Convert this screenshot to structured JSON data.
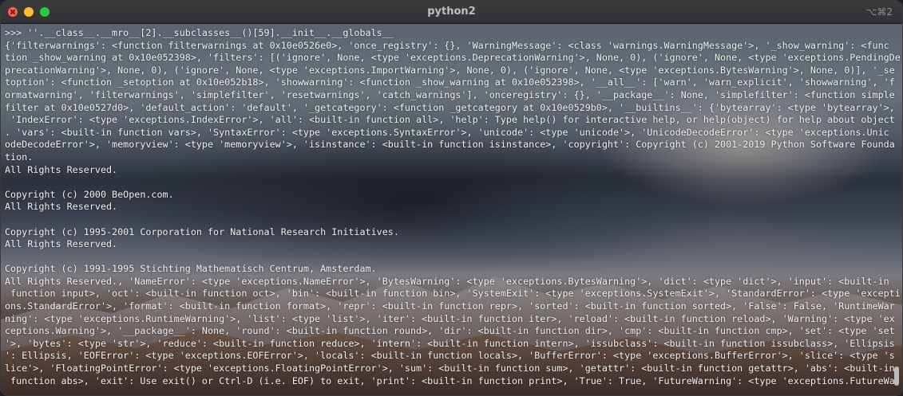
{
  "window": {
    "title": "python2",
    "shortcut": "⌥⌘2"
  },
  "terminal": {
    "lines": [
      ">>> ''.__class__.__mro__[2].__subclasses__()[59].__init__.__globals__",
      "{'filterwarnings': <function filterwarnings at 0x10e0526e0>, 'once_registry': {}, 'WarningMessage': <class 'warnings.WarningMessage'>, '_show_warning': <func",
      "tion _show_warning at 0x10e052398>, 'filters': [('ignore', None, <type 'exceptions.DeprecationWarning'>, None, 0), ('ignore', None, <type 'exceptions.PendingDe",
      "precationWarning'>, None, 0), ('ignore', None, <type 'exceptions.ImportWarning'>, None, 0), ('ignore', None, <type 'exceptions.BytesWarning'>, None, 0)], '_se",
      "toption': <function _setoption at 0x10e052b18>, 'showwarning': <function _show_warning at 0x10e052398>, '__all__': ['warn', 'warn_explicit', 'showwarning', 'f",
      "ormatwarning', 'filterwarnings', 'simplefilter', 'resetwarnings', 'catch_warnings'], 'onceregistry': {}, '__package__': None, 'simplefilter': <function simple",
      "filter at 0x10e0527d0>, 'default_action': 'default', '_getcategory': <function _getcategory at 0x10e0529b0>, '__builtins__': {'bytearray': <type 'bytearray'>,",
      " 'IndexError': <type 'exceptions.IndexError'>, 'all': <built-in function all>, 'help': Type help() for interactive help, or help(object) for help about object",
      ". 'vars': <built-in function vars>, 'SyntaxError': <type 'exceptions.SyntaxError'>, 'unicode': <type 'unicode'>, 'UnicodeDecodeError': <type 'exceptions.Unic",
      "odeDecodeError'>, 'memoryview': <type 'memoryview'>, 'isinstance': <built-in function isinstance>, 'copyright': Copyright (c) 2001-2019 Python Software Founda",
      "tion.",
      "All Rights Reserved.",
      "",
      "Copyright (c) 2000 BeOpen.com.",
      "All Rights Reserved.",
      "",
      "Copyright (c) 1995-2001 Corporation for National Research Initiatives.",
      "All Rights Reserved.",
      "",
      "Copyright (c) 1991-1995 Stichting Mathematisch Centrum, Amsterdam.",
      "All Rights Reserved., 'NameError': <type 'exceptions.NameError'>, 'BytesWarning': <type 'exceptions.BytesWarning'>, 'dict': <type 'dict'>, 'input': <built-in",
      " function input>, 'oct': <built-in function oct>, 'bin': <built-in function bin>, 'SystemExit': <type 'exceptions.SystemExit'>, 'StandardError': <type 'excepti",
      "ons.StandardError'>, 'format': <built-in function format>, 'repr': <built-in function repr>, 'sorted': <built-in function sorted>, 'False': False, 'RuntimeWar",
      "ning': <type 'exceptions.RuntimeWarning'>, 'list': <type 'list'>, 'iter': <built-in function iter>, 'reload': <built-in function reload>, 'Warning': <type 'ex",
      "ceptions.Warning'>, '__package__': None, 'round': <built-in function round>, 'dir': <built-in function dir>, 'cmp': <built-in function cmp>, 'set': <type 'set",
      "'>, 'bytes': <type 'str'>, 'reduce': <built-in function reduce>, 'intern': <built-in function intern>, 'issubclass': <built-in function issubclass>, 'Ellipsis",
      "': Ellipsis, 'EOFError': <type 'exceptions.EOFError'>, 'locals': <built-in function locals>, 'BufferError': <type 'exceptions.BufferError'>, 'slice': <type 's",
      "lice'>, 'FloatingPointError': <type 'exceptions.FloatingPointError'>, 'sum': <built-in function sum>, 'getattr': <built-in function getattr>, 'abs': <built-in",
      " function abs>, 'exit': Use exit() or Ctrl-D (i.e. EOF) to exit, 'print': <built-in function print>, 'True': True, 'FutureWarning': <type 'exceptions.FutureWa"
    ]
  },
  "colors": {
    "close": "#fe5f57",
    "minimize": "#febc2e",
    "maximize": "#28c840",
    "text": "#f2f2f2"
  }
}
